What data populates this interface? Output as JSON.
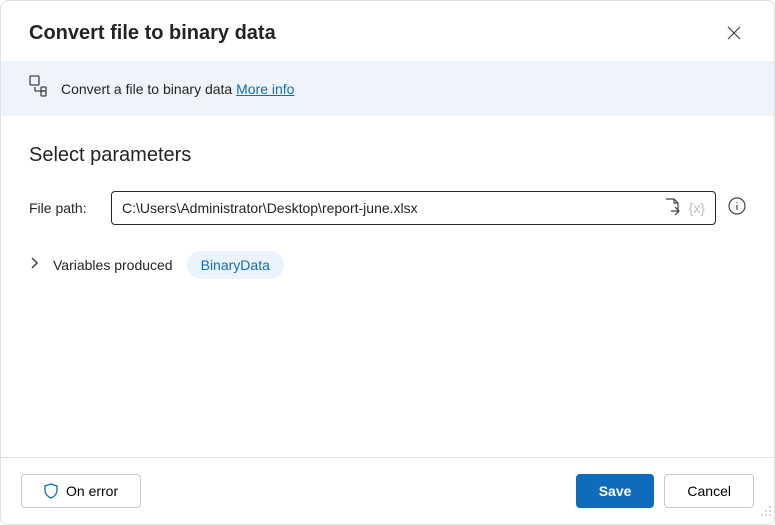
{
  "header": {
    "title": "Convert file to binary data"
  },
  "info": {
    "description": "Convert a file to binary data ",
    "more_link": "More info"
  },
  "params": {
    "section_title": "Select parameters",
    "file_path_label": "File path:",
    "file_path_value": "C:\\Users\\Administrator\\Desktop\\report-june.xlsx",
    "var_placeholder": "{x}"
  },
  "variables": {
    "label": "Variables produced",
    "produced": "BinaryData"
  },
  "footer": {
    "on_error": "On error",
    "save": "Save",
    "cancel": "Cancel"
  }
}
